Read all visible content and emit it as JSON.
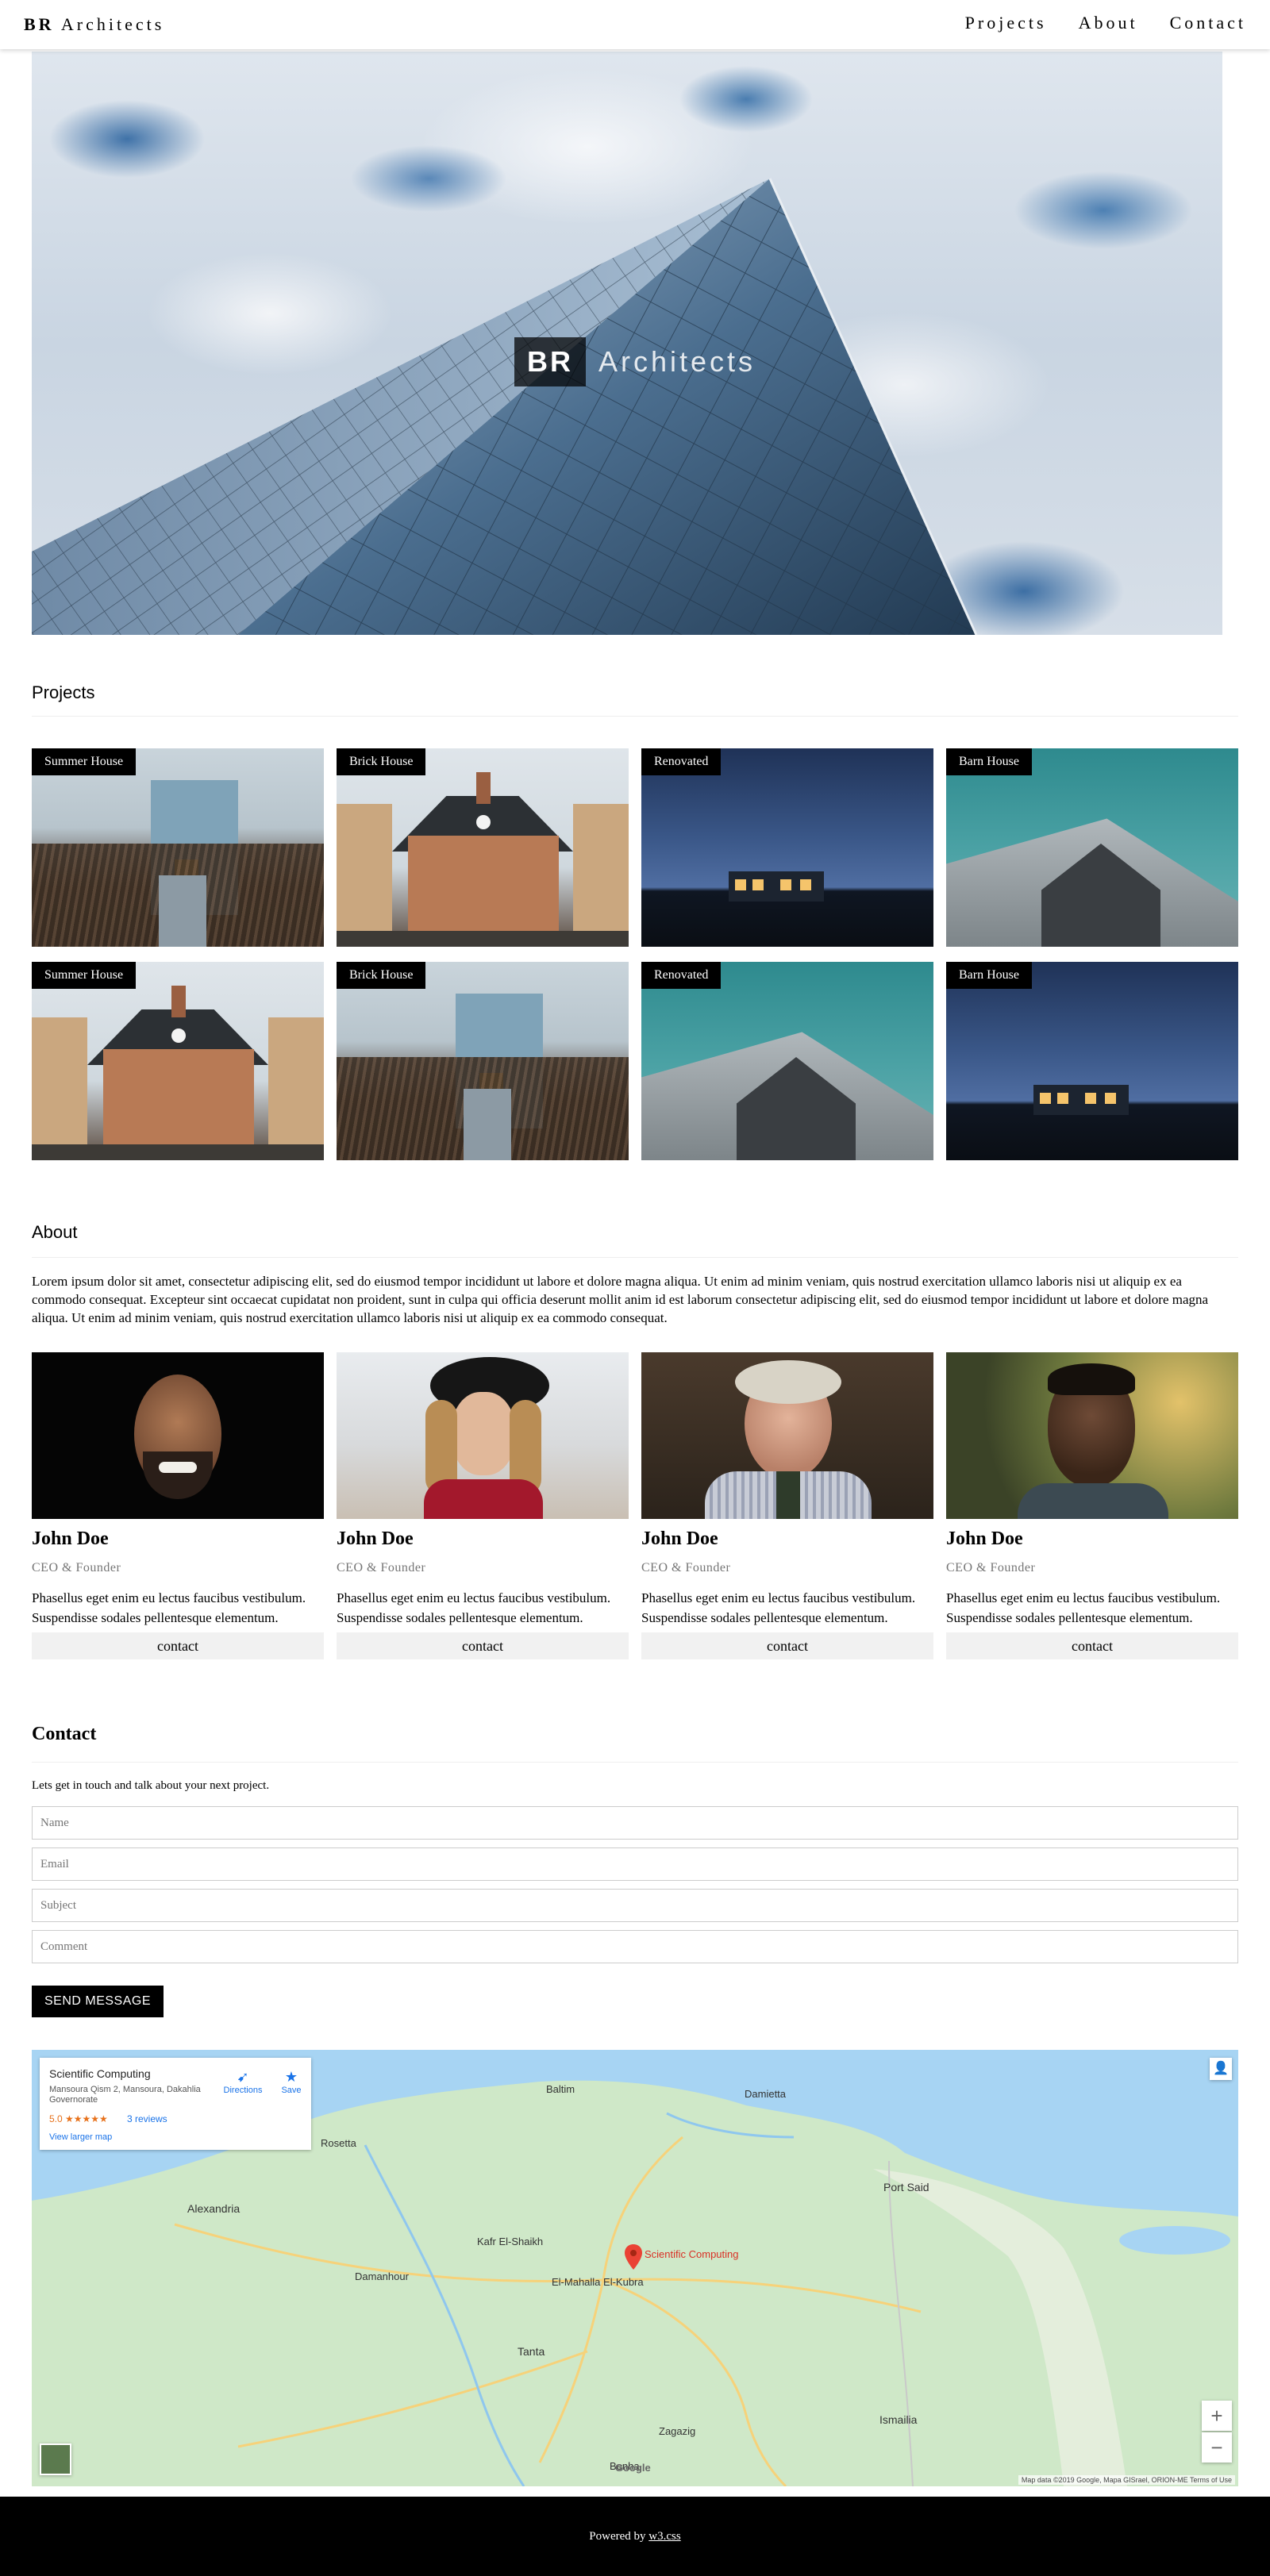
{
  "nav": {
    "brand_bold": "BR",
    "brand_rest": "Architects",
    "links": [
      "Projects",
      "About",
      "Contact"
    ]
  },
  "hero": {
    "logo_box": "BR",
    "logo_text": "Architects"
  },
  "projects": {
    "title": "Projects",
    "items": [
      {
        "label": "Summer House",
        "scene": "summer"
      },
      {
        "label": "Brick House",
        "scene": "brick"
      },
      {
        "label": "Renovated",
        "scene": "renovated"
      },
      {
        "label": "Barn House",
        "scene": "barn"
      },
      {
        "label": "Summer House",
        "scene": "brick"
      },
      {
        "label": "Brick House",
        "scene": "summer"
      },
      {
        "label": "Renovated",
        "scene": "barn"
      },
      {
        "label": "Barn House",
        "scene": "renovated"
      }
    ]
  },
  "about": {
    "title": "About",
    "text": "Lorem ipsum dolor sit amet, consectetur adipiscing elit, sed do eiusmod tempor incididunt ut labore et dolore magna aliqua. Ut enim ad minim veniam, quis nostrud exercitation ullamco laboris nisi ut aliquip ex ea commodo consequat. Excepteur sint occaecat cupidatat non proident, sunt in culpa qui officia deserunt mollit anim id est laborum consectetur adipiscing elit, sed do eiusmod tempor incididunt ut labore et dolore magna aliqua. Ut enim ad minim veniam, quis nostrud exercitation ullamco laboris nisi ut aliquip ex ea commodo consequat.",
    "team": [
      {
        "name": "John Doe",
        "role": "CEO & Founder",
        "desc": "Phasellus eget enim eu lectus faucibus vestibulum. Suspendisse sodales pellentesque elementum.",
        "button": "contact"
      },
      {
        "name": "John Doe",
        "role": "CEO & Founder",
        "desc": "Phasellus eget enim eu lectus faucibus vestibulum. Suspendisse sodales pellentesque elementum.",
        "button": "contact"
      },
      {
        "name": "John Doe",
        "role": "CEO & Founder",
        "desc": "Phasellus eget enim eu lectus faucibus vestibulum. Suspendisse sodales pellentesque elementum.",
        "button": "contact"
      },
      {
        "name": "John Doe",
        "role": "CEO & Founder",
        "desc": "Phasellus eget enim eu lectus faucibus vestibulum. Suspendisse sodales pellentesque elementum.",
        "button": "contact"
      }
    ]
  },
  "contact": {
    "title": "Contact",
    "subtitle": "Lets get in touch and talk about your next project.",
    "fields": {
      "name": "Name",
      "email": "Email",
      "subject": "Subject",
      "comment": "Comment"
    },
    "send_label": "SEND MESSAGE"
  },
  "map": {
    "place_title": "Scientific Computing",
    "address": "Mansoura Qism 2, Mansoura, Dakahlia Governorate",
    "rating": "5.0 ★★★★★",
    "reviews": "3 reviews",
    "larger_map": "View larger map",
    "directions": "Directions",
    "save": "Save",
    "pin_label": "Scientific Computing",
    "cities": [
      {
        "name": "Alexandria",
        "k": "alex"
      },
      {
        "name": "Damietta",
        "k": "dam"
      },
      {
        "name": "Port Said",
        "k": "ps"
      },
      {
        "name": "Tanta",
        "k": "tanta"
      },
      {
        "name": "Zagazig",
        "k": "zag"
      },
      {
        "name": "Ismailia",
        "k": "ism"
      },
      {
        "name": "Kafr El-Shaikh",
        "k": "kafr"
      },
      {
        "name": "Damanhour",
        "k": "dmn"
      },
      {
        "name": "El-Mahalla El-Kubra",
        "k": "mah"
      },
      {
        "name": "Benha",
        "k": "benha"
      },
      {
        "name": "Rosetta",
        "k": "ros"
      },
      {
        "name": "Baltim",
        "k": "bal"
      }
    ],
    "zoom_in": "+",
    "zoom_out": "−",
    "footer": "Map data ©2019 Google, Mapa GISrael, ORION-ME   Terms of Use",
    "google": "Google"
  },
  "footer": {
    "prefix": "Powered by ",
    "link": "w3.css"
  },
  "colors": {
    "accent": "#000000",
    "button_bg": "#f1f1f1",
    "role_text": "#757575",
    "map_water": "#a7d4f3",
    "map_land": "#cfe8c8",
    "pin": "#ea4335"
  }
}
